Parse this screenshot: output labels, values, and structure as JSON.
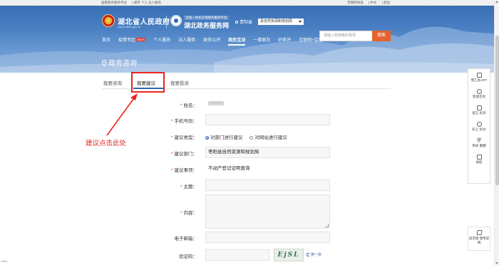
{
  "topbar": {
    "left_links": [
      "国家政务服务平台",
      "| 城市 个人 法人服务"
    ],
    "right_links": [
      "无障碍阅读",
      "| 中文",
      "| 退出"
    ]
  },
  "header": {
    "gov_name": "湖北省人民政府",
    "gov_sub": "www.hubei.gov.cn",
    "service_top": "全国一体化在线政务服务平台",
    "service_name": "湖北政务服务网",
    "location_label": "贵阳县",
    "location_select": "县自然资源和规划局"
  },
  "nav": [
    {
      "label": "首页"
    },
    {
      "label": "疫情专区",
      "badge": "NEW"
    },
    {
      "label": "个人服务"
    },
    {
      "label": "法人服务"
    },
    {
      "label": "政务公开"
    },
    {
      "label": "政民互动",
      "active": true
    },
    {
      "label": "一事联办"
    },
    {
      "label": "好差评"
    },
    {
      "label": "互联网+监管"
    }
  ],
  "search": {
    "placeholder": "请输入想搜索的事项",
    "button": "搜索"
  },
  "page_title": "政务咨询",
  "tabs": [
    {
      "label": "我要咨询"
    },
    {
      "label": "我要建议",
      "active": true
    },
    {
      "label": "我要投诉"
    }
  ],
  "annotation": "建议点击此处",
  "form": {
    "name_label": "姓名：",
    "phone_label": "手机号码：",
    "type_label": "建议类型：",
    "type_option1": "对部门进行建议",
    "type_option2": "对网站进行建议",
    "dept_label": "建议部门：",
    "dept_value": "枣阳县自然资源和规划局",
    "matter_label": "建议事项：",
    "matter_value": "不动产登记证明查询",
    "subject_label": "主题：",
    "content_label": "内容：",
    "email_label": "电子邮箱：",
    "captcha_label": "验证码：",
    "captcha_text": "EjSL",
    "captcha_refresh": "换一张"
  },
  "sidebar": {
    "items": [
      "鄂汇办APP",
      "智能咨询",
      "留言 投诉",
      "码上 好办",
      "简体 繁體",
      "收起"
    ],
    "bottom": "适老版 使用说明"
  },
  "colors": {
    "accent": "#2f67b1",
    "highlight": "#e8251f",
    "search_button": "#e7612c"
  }
}
